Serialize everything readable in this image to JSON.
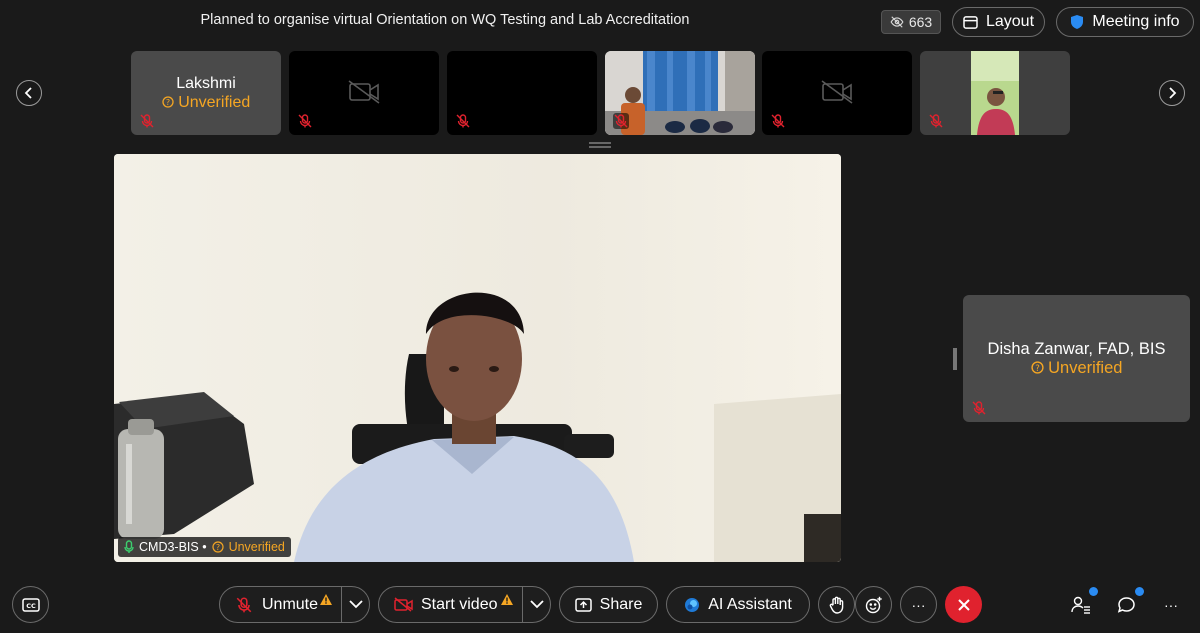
{
  "header": {
    "title": "Planned to organise virtual Orientation on WQ Testing and Lab Accreditation",
    "viewer_count": "663",
    "layout_label": "Layout",
    "meeting_info_label": "Meeting info"
  },
  "filmstrip": {
    "tiles": [
      {
        "name": "Lakshmi",
        "status": "Unverified"
      }
    ]
  },
  "main_video": {
    "name": "CMD3-BIS •",
    "status": "Unverified"
  },
  "side_tile": {
    "name": "Disha Zanwar, FAD, BIS",
    "status": "Unverified"
  },
  "controls": {
    "unmute_label": "Unmute",
    "start_video_label": "Start video",
    "share_label": "Share",
    "ai_assistant_label": "AI Assistant",
    "more_label": "···",
    "overflow_label": "···"
  },
  "colors": {
    "accent_warning": "#f5a623",
    "leave_red": "#e0222e",
    "notify_blue": "#2a8bf2"
  }
}
